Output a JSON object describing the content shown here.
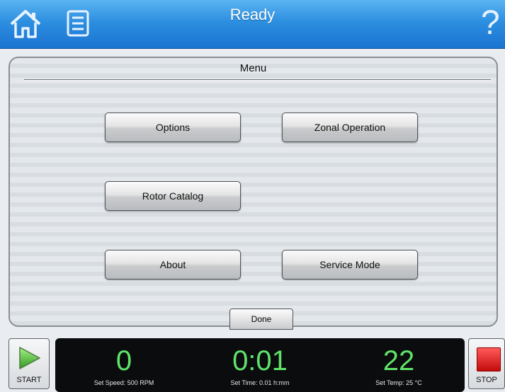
{
  "header": {
    "title": "Ready"
  },
  "menu": {
    "title": "Menu",
    "buttons": {
      "options": "Options",
      "zonal_operation": "Zonal Operation",
      "rotor_catalog": "Rotor Catalog",
      "about": "About",
      "service_mode": "Service Mode"
    },
    "done": "Done"
  },
  "controls": {
    "start": "START",
    "stop": "STOP"
  },
  "readouts": {
    "speed": {
      "value": "0",
      "setting": "Set Speed: 500 RPM"
    },
    "time": {
      "value": "0:01",
      "setting": "Set Time: 0.01 h:mm"
    },
    "temp": {
      "value": "22",
      "setting": "Set Temp: 25 °C"
    }
  },
  "colors": {
    "header_blue": "#2d8fe0",
    "readout_green": "#5fe36a",
    "stop_red": "#d81414",
    "start_green": "#3fae2c"
  },
  "icons": {
    "home": "home-icon",
    "list": "list-icon",
    "help": "help-icon",
    "start": "play-icon",
    "stop": "stop-icon"
  }
}
